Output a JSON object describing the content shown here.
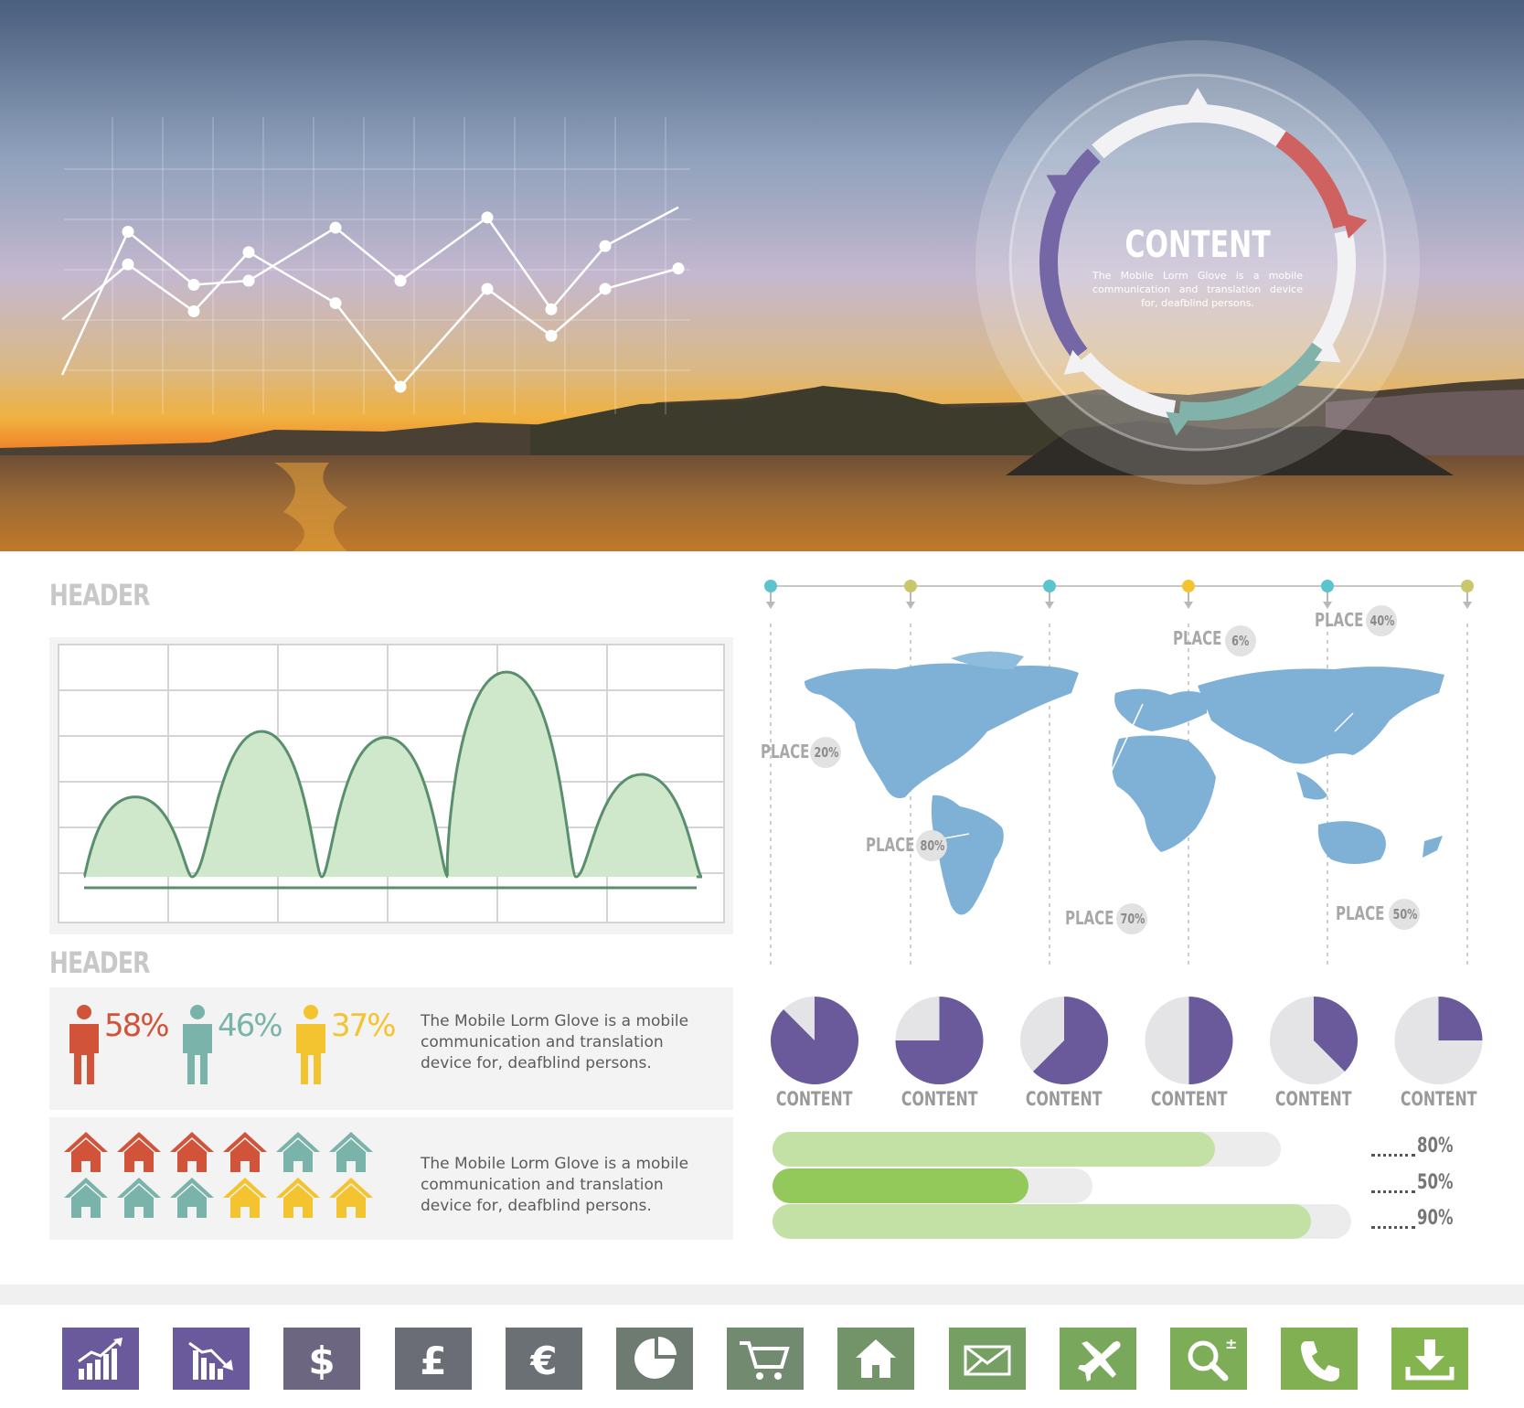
{
  "hero": {
    "ring_title": "CONTENT",
    "ring_text": "The Mobile Lorm Glove is a mobile communication and translation device for, deafblind persons."
  },
  "line_chart": {
    "type": "line",
    "x": [
      0,
      1,
      2,
      3,
      4,
      5,
      6,
      7,
      8,
      9,
      10
    ],
    "series": [
      {
        "values": [
          0.0,
          0.76,
          0.5,
          0.52,
          0.78,
          0.52,
          0.83,
          0.38,
          0.69,
          0.88,
          null
        ]
      },
      {
        "values": [
          0.33,
          0.6,
          0.37,
          0.66,
          0.41,
          0.0,
          0.48,
          0.25,
          0.48,
          0.58,
          0.58
        ]
      }
    ],
    "grid": true
  },
  "area_chart": {
    "type": "area",
    "header": "HEADER",
    "peaks": [
      0.39,
      0.71,
      0.68,
      1.0,
      0.5
    ],
    "grid": true,
    "color": "#cfe8cc",
    "line_color": "#5a8f6e"
  },
  "people": {
    "header": "HEADER",
    "items": [
      {
        "value": "58%",
        "color": "#d1543a"
      },
      {
        "value": "46%",
        "color": "#7ab3aa"
      },
      {
        "value": "37%",
        "color": "#f4c430"
      }
    ],
    "text": "The Mobile Lorm Glove is a mobile communication and translation device for, deafblind persons."
  },
  "houses": {
    "rows": [
      [
        "#d1543a",
        "#d1543a",
        "#d1543a",
        "#d1543a",
        "#7ab3aa",
        "#7ab3aa"
      ],
      [
        "#7ab3aa",
        "#7ab3aa",
        "#7ab3aa",
        "#f4c430",
        "#f4c430",
        "#f4c430"
      ]
    ],
    "text": "The Mobile Lorm Glove is a mobile communication and translation device for, deafblind persons."
  },
  "map": {
    "timeline_colors": [
      "#5bc4cc",
      "#c9c76a",
      "#5bc4cc",
      "#f4c430",
      "#5bc4cc",
      "#c9c76a"
    ],
    "places": [
      {
        "label": "PLACE",
        "value": "20%"
      },
      {
        "label": "PLACE",
        "value": "80%"
      },
      {
        "label": "PLACE",
        "value": "70%"
      },
      {
        "label": "PLACE",
        "value": "6%"
      },
      {
        "label": "PLACE",
        "value": "40%"
      },
      {
        "label": "PLACE",
        "value": "50%"
      }
    ]
  },
  "pies": {
    "type": "pie",
    "color": "#6a5a9c",
    "rest_color": "#e4e4e6",
    "items": [
      {
        "label": "CONTENT",
        "fraction": 0.875
      },
      {
        "label": "CONTENT",
        "fraction": 0.75
      },
      {
        "label": "CONTENT",
        "fraction": 0.625
      },
      {
        "label": "CONTENT",
        "fraction": 0.5
      },
      {
        "label": "CONTENT",
        "fraction": 0.375
      },
      {
        "label": "CONTENT",
        "fraction": 0.25
      }
    ]
  },
  "bars": {
    "type": "bar",
    "items": [
      {
        "value": "80%",
        "fraction": 0.87,
        "color": "#c3e0a5"
      },
      {
        "value": "50%",
        "fraction": 0.8,
        "color": "#92c95a"
      },
      {
        "value": "90%",
        "fraction": 0.93,
        "color": "#c3e0a5"
      }
    ]
  },
  "icons": [
    {
      "name": "chart-up-icon",
      "color": "#6a5a9c"
    },
    {
      "name": "chart-down-icon",
      "color": "#6a5a9c"
    },
    {
      "name": "dollar-icon",
      "color": "#6d6680"
    },
    {
      "name": "pound-icon",
      "color": "#6b6d76"
    },
    {
      "name": "euro-icon",
      "color": "#6a7074"
    },
    {
      "name": "pie-chart-icon",
      "color": "#6e7b70"
    },
    {
      "name": "cart-icon",
      "color": "#728a6f"
    },
    {
      "name": "home-icon",
      "color": "#739468"
    },
    {
      "name": "mail-icon",
      "color": "#76a063"
    },
    {
      "name": "plane-icon",
      "color": "#79a75c"
    },
    {
      "name": "search-icon",
      "color": "#7dad57"
    },
    {
      "name": "phone-icon",
      "color": "#80b052"
    },
    {
      "name": "download-icon",
      "color": "#84b44e"
    }
  ]
}
